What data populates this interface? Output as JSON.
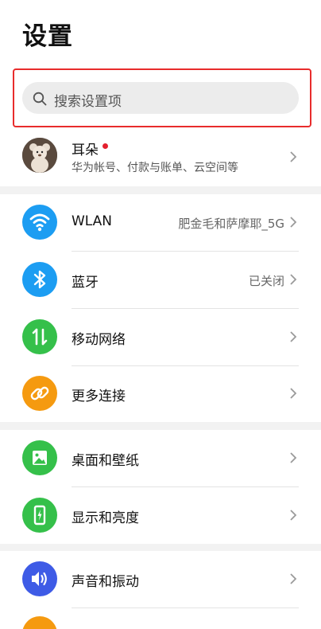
{
  "header": {
    "title": "设置"
  },
  "search": {
    "placeholder": "搜索设置项"
  },
  "account": {
    "name": "耳朵",
    "subtitle": "华为帐号、付款与账单、云空间等"
  },
  "groups": [
    {
      "items": [
        {
          "label": "WLAN",
          "value": "肥金毛和萨摩耶_5G",
          "icon": "wifi-icon",
          "color": "#1c9df2"
        },
        {
          "label": "蓝牙",
          "value": "已关闭",
          "icon": "bluetooth-icon",
          "color": "#1c9df2"
        },
        {
          "label": "移动网络",
          "value": "",
          "icon": "mobile-network-icon",
          "color": "#35c04a"
        },
        {
          "label": "更多连接",
          "value": "",
          "icon": "link-icon",
          "color": "#f59a10"
        }
      ]
    },
    {
      "items": [
        {
          "label": "桌面和壁纸",
          "value": "",
          "icon": "wallpaper-icon",
          "color": "#35c04a"
        },
        {
          "label": "显示和亮度",
          "value": "",
          "icon": "display-icon",
          "color": "#35c04a"
        }
      ]
    },
    {
      "items": [
        {
          "label": "声音和振动",
          "value": "",
          "icon": "sound-icon",
          "color": "#3e5be6"
        }
      ]
    }
  ],
  "colors": {
    "accent_red": "#e82c2c",
    "background": "#f2f2f2"
  }
}
